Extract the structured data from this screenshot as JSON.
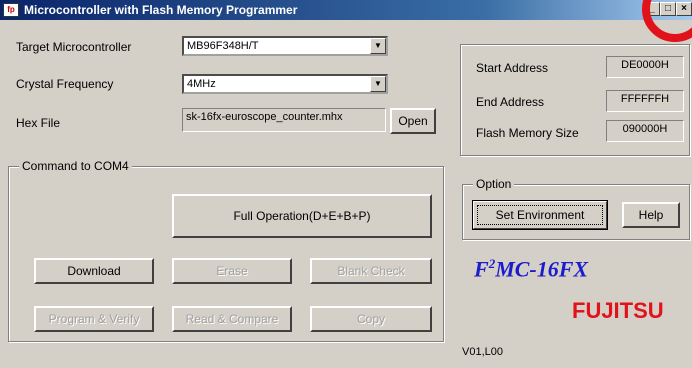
{
  "window": {
    "title": "Microcontroller with Flash Memory Programmer",
    "app_icon_text": "fp",
    "min_glyph": "_",
    "max_glyph": "□",
    "close_glyph": "×"
  },
  "form": {
    "target_label": "Target Microcontroller",
    "target_value": "MB96F348H/T",
    "crystal_label": "Crystal Frequency",
    "crystal_value": "4MHz",
    "hex_label": "Hex File",
    "hex_value": "sk-16fx-euroscope_counter.mhx",
    "open_label": "Open"
  },
  "address_panel": {
    "start_label": "Start Address",
    "start_value": "DE0000H",
    "end_label": "End Address",
    "end_value": "FFFFFFH",
    "flash_label": "Flash Memory Size",
    "flash_value": "090000H"
  },
  "command": {
    "group_label": "Command to COM4",
    "full_operation": "Full Operation(D+E+B+P)",
    "download": "Download",
    "erase": "Erase",
    "blank_check": "Blank Check",
    "program_verify": "Program & Verify",
    "read_compare": "Read & Compare",
    "copy": "Copy"
  },
  "option": {
    "group_label": "Option",
    "set_environment": "Set Environment",
    "help": "Help"
  },
  "branding": {
    "product_prefix": "F",
    "product_sup": "2",
    "product_suffix": "MC-16FX",
    "company": "FUJITSU",
    "version": "V01,L00"
  },
  "colors": {
    "accent_ring": "#e2121a",
    "brand_blue": "#1c1ccc",
    "fujitsu_red": "#e2121a"
  }
}
